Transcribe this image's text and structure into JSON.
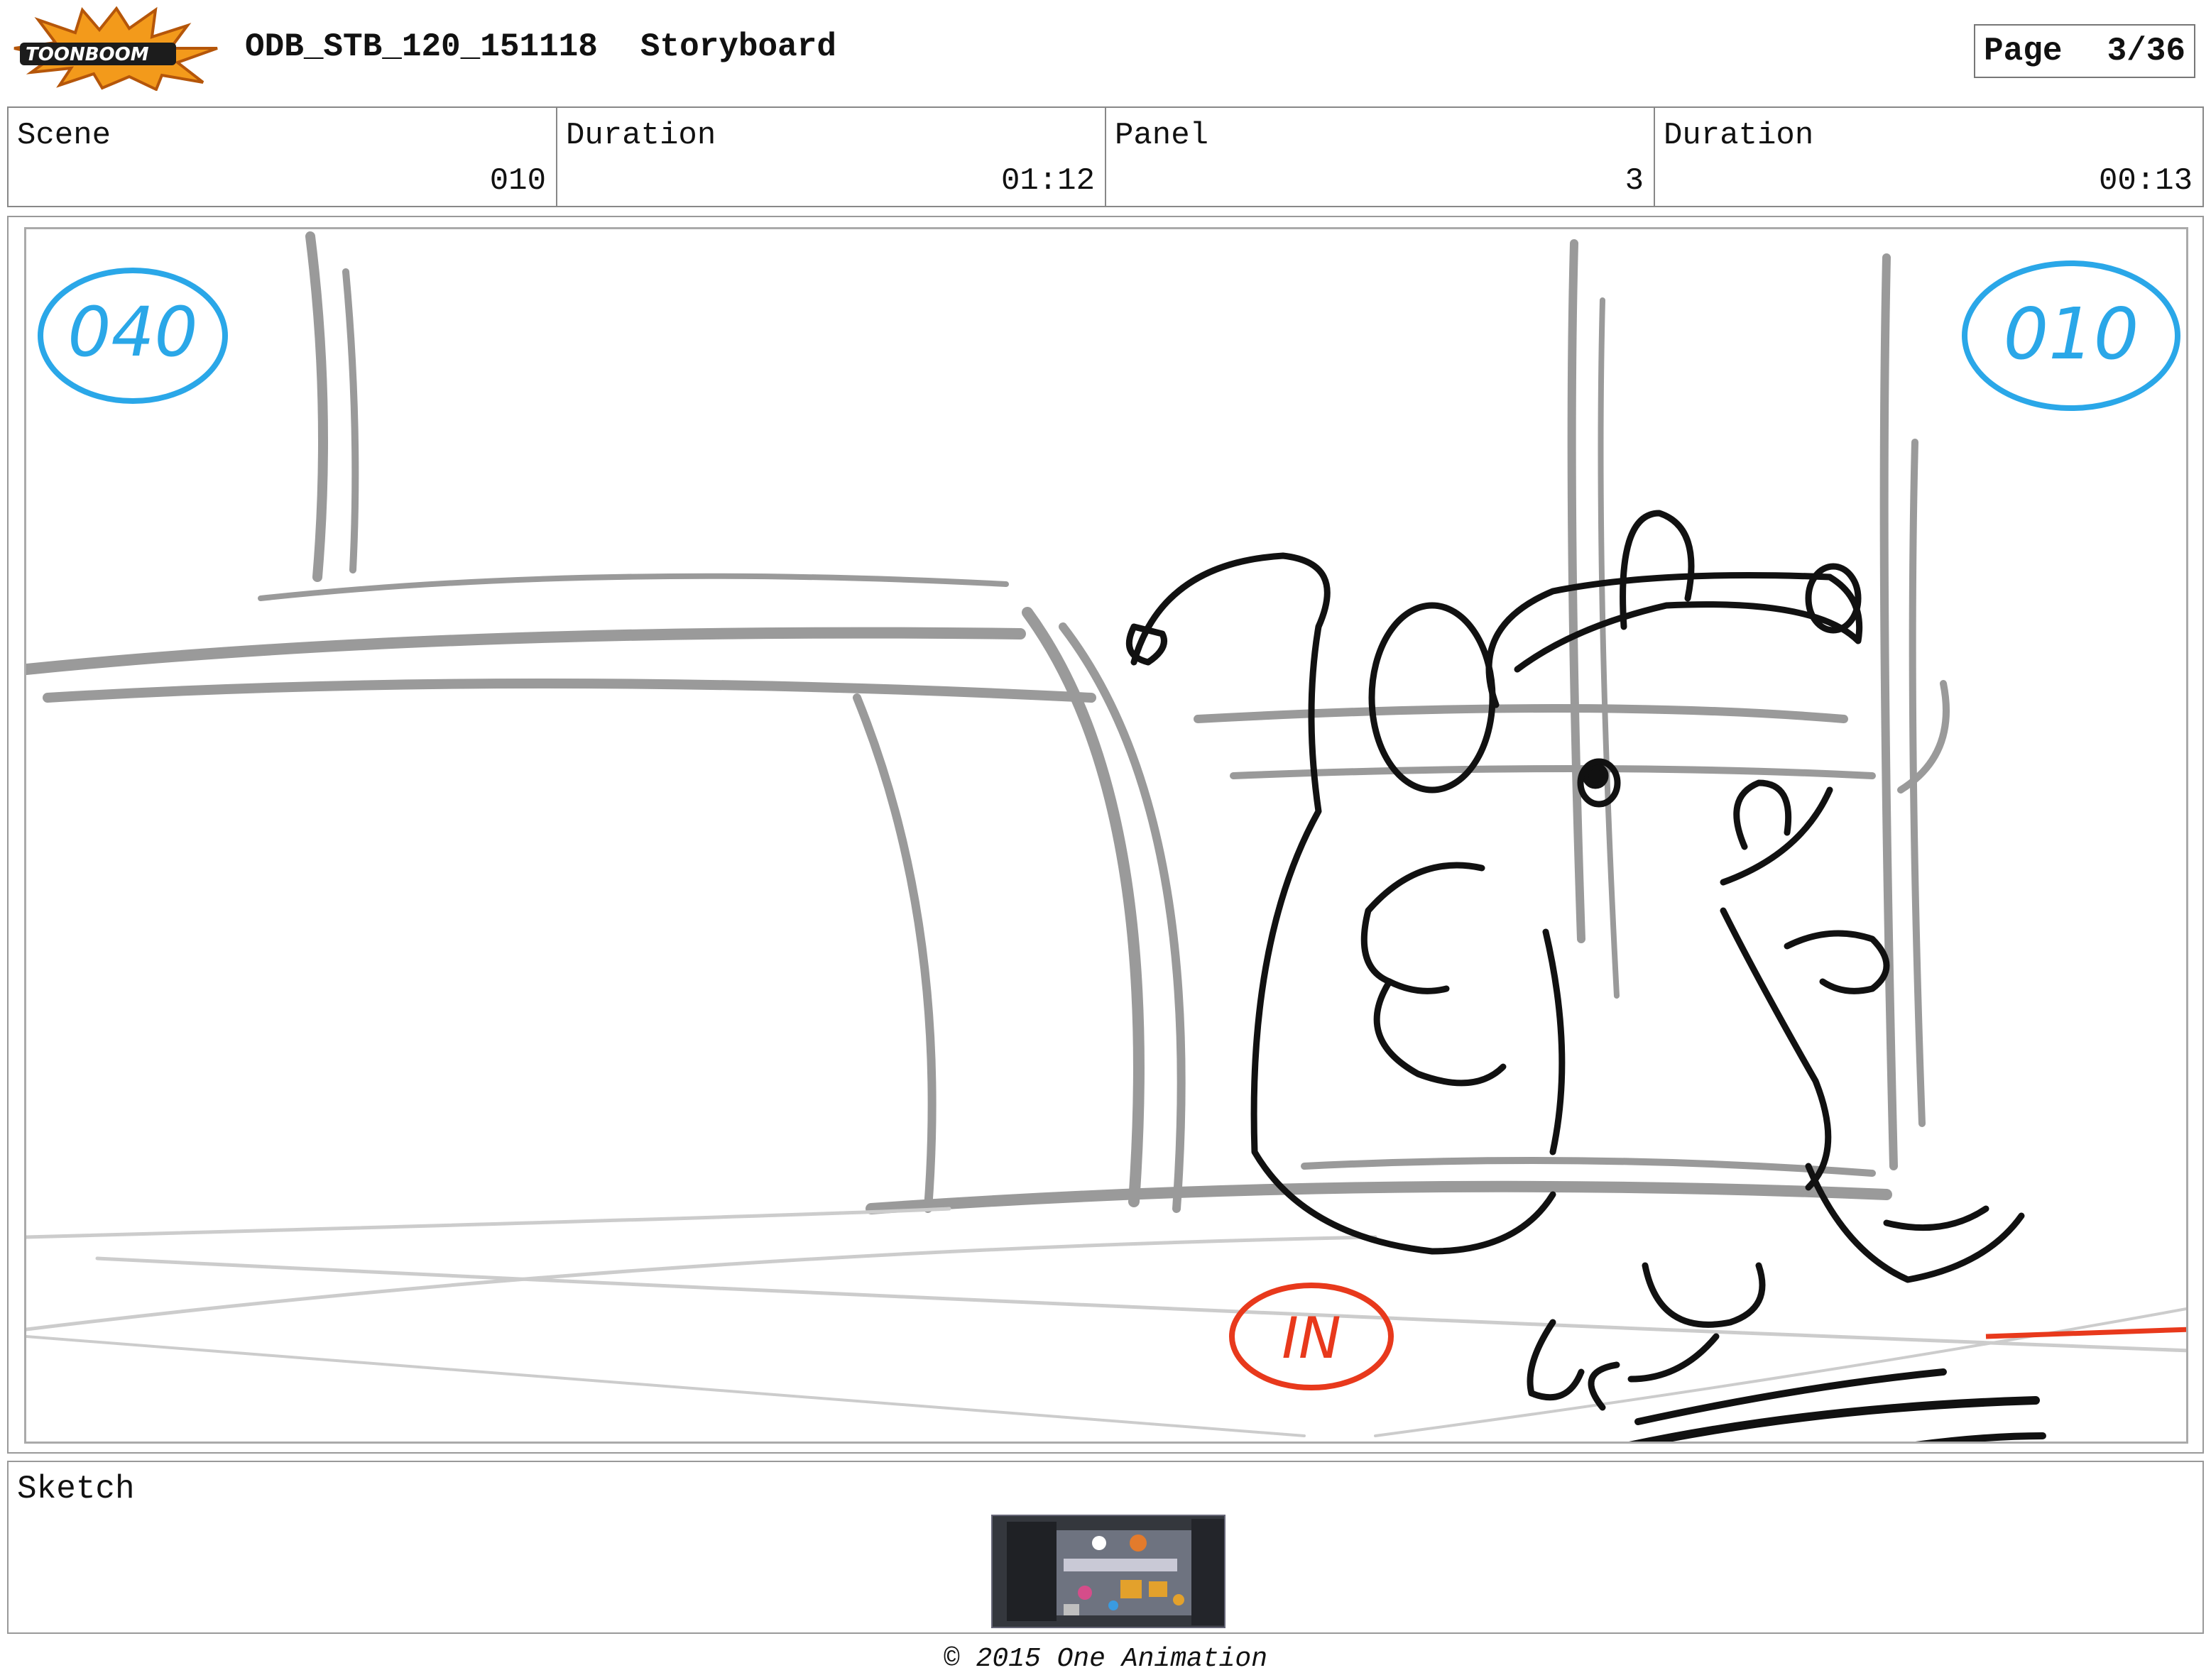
{
  "header": {
    "logo_text": "TOONBOOM",
    "project_code": "ODB_STB_120_151118",
    "document_type": "Storyboard",
    "page_label": "Page",
    "page_value": "3/36"
  },
  "info": {
    "scene_label": "Scene",
    "scene_value": "010",
    "scene_duration_label": "Duration",
    "scene_duration_value": "01:12",
    "panel_label": "Panel",
    "panel_value": "3",
    "panel_duration_label": "Duration",
    "panel_duration_value": "00:13"
  },
  "panel": {
    "left_marker": "040",
    "right_marker": "010",
    "in_marker": "IN",
    "marker_blue": "#2aa7e8",
    "marker_red": "#e8391c"
  },
  "sketch": {
    "label": "Sketch"
  },
  "footer": {
    "copyright": "© 2015 One Animation"
  }
}
